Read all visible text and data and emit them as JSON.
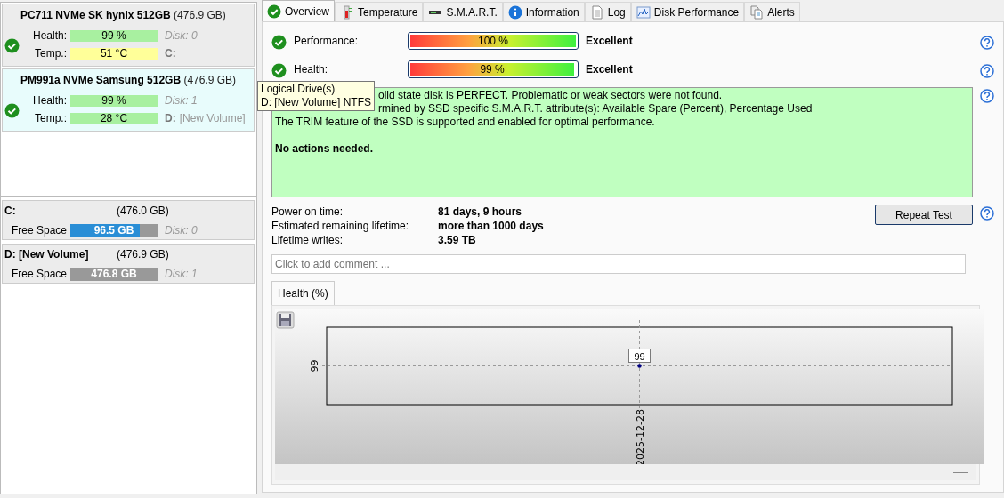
{
  "drives": [
    {
      "name": "PC711 NVMe SK hynix 512GB",
      "size": "(476.9 GB)",
      "selected": false,
      "health_label": "Health:",
      "health": "99 %",
      "temp_label": "Temp.:",
      "temp": {
        "text": "51 °C",
        "color": "#ffff99"
      },
      "disk": "Disk: 0",
      "letter": "C:"
    },
    {
      "name": "PM991a NVMe Samsung 512GB",
      "size": "(476.9 GB)",
      "selected": true,
      "health_label": "Health:",
      "health": "99 %",
      "temp_label": "Temp.:",
      "temp": {
        "text": "28 °C",
        "color": "#a8f0a0"
      },
      "disk": "Disk: 1",
      "letter": "D:",
      "volume_label": "[New Volume]"
    }
  ],
  "volumes": [
    {
      "name": "C:",
      "size": "(476.0 GB)",
      "free_label": "Free Space",
      "free": "96.5 GB",
      "level": 0.8,
      "disk": "Disk: 0"
    },
    {
      "name": "D: [New Volume]",
      "size": "(476.9 GB)",
      "free_label": "Free Space",
      "free": "476.8 GB",
      "level": 0,
      "disk": "Disk: 1"
    }
  ],
  "tooltip": {
    "lines": [
      "Logical Drive(s)",
      "D: [New Volume] NTFS"
    ]
  },
  "tabs": [
    {
      "label": "Overview",
      "selected": true
    },
    {
      "label": "Temperature",
      "selected": false
    },
    {
      "label": "S.M.A.R.T.",
      "selected": false
    },
    {
      "label": "Information",
      "selected": false
    },
    {
      "label": "Log",
      "selected": false
    },
    {
      "label": "Disk Performance",
      "selected": false
    },
    {
      "label": "Alerts",
      "selected": false
    }
  ],
  "ratings": [
    {
      "label": "Performance:",
      "reading": "100 %",
      "level": 1,
      "verdict": "Excellent"
    },
    {
      "label": "Health:",
      "reading": "99 %",
      "level": 0.99,
      "verdict": "Excellent"
    }
  ],
  "status": {
    "lines": [
      "olid state disk is PERFECT. Problematic or weak sectors were not found.",
      "rmined by SSD specific S.M.A.R.T. attribute(s):  Available Spare (Percent), Percentage Used",
      "The TRIM feature of the SSD is supported and enabled for optimal performance."
    ],
    "action": "No actions needed."
  },
  "facts": [
    {
      "label": "Power on time:",
      "value": "81 days, 9 hours"
    },
    {
      "label": "Estimated remaining lifetime:",
      "value": "more than 1000 days"
    },
    {
      "label": "Lifetime writes:",
      "value": "3.59 TB"
    }
  ],
  "repeat_button": "Repeat Test",
  "comment": {
    "placeholder": "Click to add comment ..."
  },
  "chart_tab": "Health (%)",
  "health_chart": {
    "y_label": "99",
    "date": "2025-12-28",
    "point_label": "99"
  }
}
